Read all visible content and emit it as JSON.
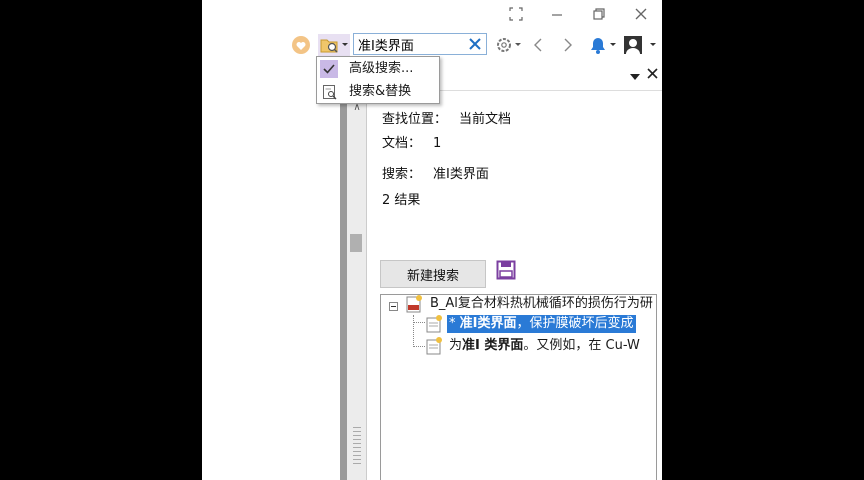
{
  "toolbar": {
    "search_value": "准I类界面"
  },
  "panel": {
    "location_label": "查找位置：",
    "location_value": "当前文档",
    "docs_label": "文档：",
    "docs_value": "1",
    "search_label": "搜索：",
    "search_value": "准I类界面",
    "results_count": "2 结果",
    "new_search_label": "新建搜索"
  },
  "results": {
    "doc_title": "B_Al复合材料热机械循环的损伤行为研",
    "items": [
      {
        "prefix": "* ",
        "bold": "准I类界面",
        "rest": "，保护膜破坏后变成"
      },
      {
        "prefix": "为",
        "bold": "准I 类界面",
        "rest": "。又例如，在 Cu-W"
      }
    ]
  },
  "dropdown": {
    "items": [
      {
        "label": "高级搜索...",
        "checked": true
      },
      {
        "label": "搜索&替换",
        "checked": false
      }
    ]
  },
  "colors": {
    "selection": "#2a7ad6",
    "menu_check_bg": "#c9b9e6",
    "search_border": "#8ab0d8",
    "save_icon": "#7b3fa0",
    "clear_x": "#1e6fc4"
  }
}
